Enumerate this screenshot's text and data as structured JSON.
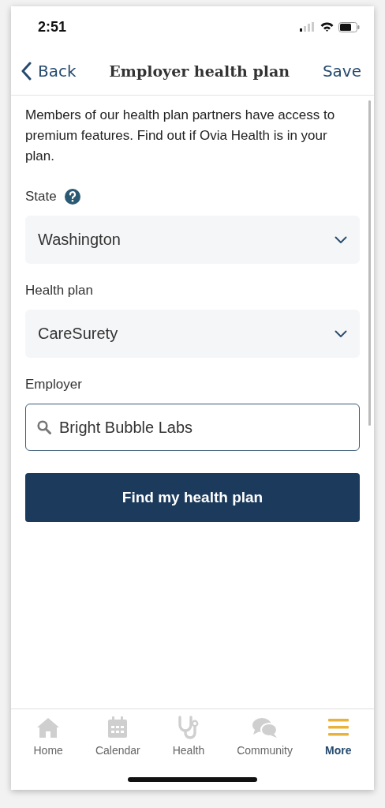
{
  "status_bar": {
    "time": "2:51"
  },
  "nav": {
    "back": "Back",
    "title": "Employer health plan",
    "action": "Save"
  },
  "intro": "Members of our health plan partners have access to premium features. Find out if Ovia Health is in your plan.",
  "fields": [
    {
      "kind": "select",
      "label": "State",
      "help": true,
      "value": "Washington"
    },
    {
      "kind": "select",
      "label": "Health plan",
      "help": false,
      "value": "CareSurety"
    },
    {
      "kind": "search",
      "label": "Employer",
      "help": false,
      "value": "Bright Bubble Labs"
    }
  ],
  "submit": "Find my health plan",
  "tab_bar": [
    {
      "kind": "home",
      "label": "Home",
      "selected": false
    },
    {
      "kind": "calendar",
      "label": "Calendar",
      "selected": false
    },
    {
      "kind": "health",
      "label": "Health",
      "selected": false
    },
    {
      "kind": "community",
      "label": "Community",
      "selected": false
    },
    {
      "kind": "more",
      "label": "More",
      "selected": true
    }
  ]
}
